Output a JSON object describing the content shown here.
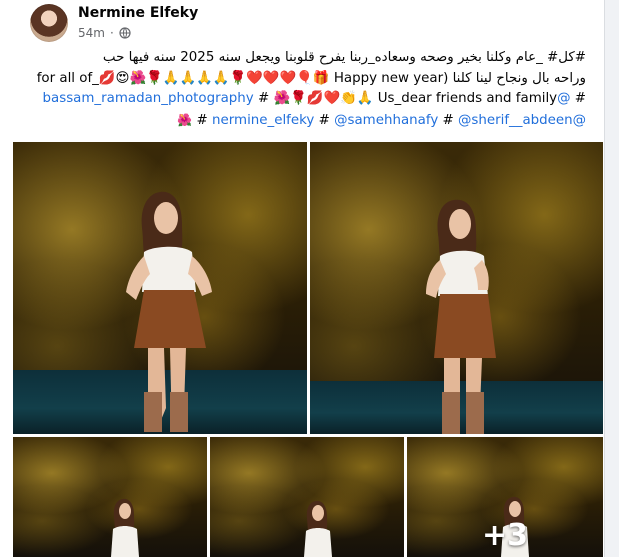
{
  "post": {
    "author": "Nermine Elfeky",
    "timestamp": "54m",
    "separator": "·",
    "privacy_icon": "globe-icon"
  },
  "caption": {
    "line1": "#كل# _عام وكلنا بخير وصحه وسعاده_ربنا يفرح قلوبنا ويجعل سنه 2025  سنه فيها حب",
    "line2": "وراحه بال ونجاح لينا كلنا (for all of_💋😍🌺🌹🙏🙏🙏🙏🌹❤️❤️❤️🎈🎁 Happy new year",
    "line3_mention": "@bassam_ramadan_photography",
    "line3_text": "# 🌺🌹💋❤️👏🙏 Us_dear friends and family",
    "line3_hash": "#",
    "line4_mention1": "@sherif__abdeen",
    "line4_mention2": "@samehhanafy",
    "line4_mention3": "@nermine_elfeky",
    "line4_hash1": "#",
    "line4_hash2": "#",
    "line4_hash3": "#",
    "line4_emoji": "🌺"
  },
  "photos": {
    "more_count": "+3"
  },
  "colors": {
    "link": "#216fdb",
    "text": "#050505",
    "meta": "#65676b",
    "page_bg": "#f0f2f5"
  }
}
